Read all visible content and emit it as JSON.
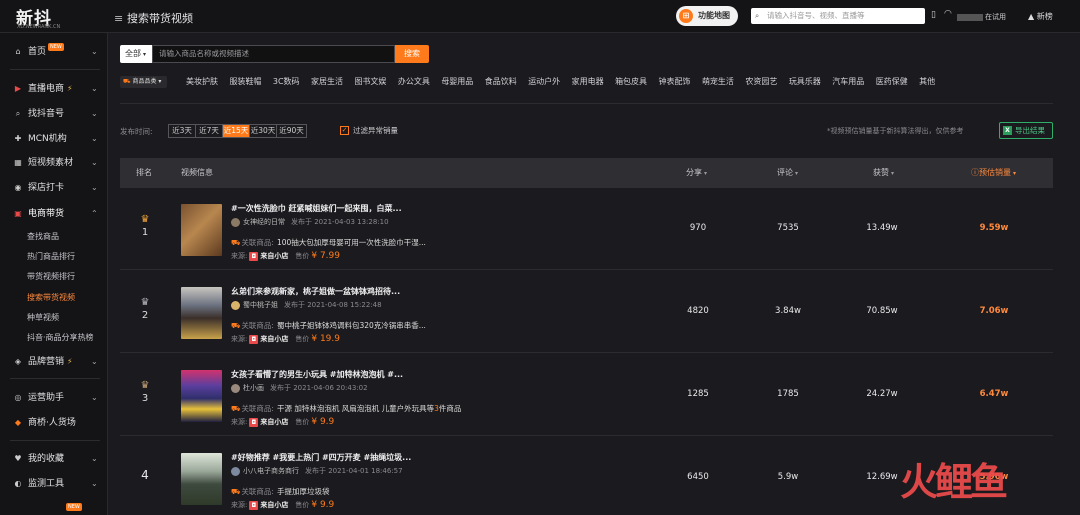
{
  "header": {
    "logo_text": "新抖",
    "logo_sub": "XD.NEWRANK.CN",
    "page_title": "搜索带货视频",
    "func_map": "功能地图",
    "search_placeholder": "请输入抖音号、视频、直播等",
    "trial": "在试用",
    "new_label": "新榜",
    "icons": [
      "menu-icon",
      "search-icon",
      "phone-icon",
      "headset-icon",
      "new-icon"
    ]
  },
  "sidebar": {
    "items": [
      {
        "label": "首页",
        "icon": "home-icon",
        "tag": "NEW"
      },
      {
        "label": "直播电商",
        "icon": "live-icon"
      },
      {
        "label": "找抖音号",
        "icon": "search-icon"
      },
      {
        "label": "MCN机构",
        "icon": "mcn-icon"
      },
      {
        "label": "短视频素材",
        "icon": "grid-icon"
      },
      {
        "label": "探店打卡",
        "icon": "location-icon"
      },
      {
        "label": "电商带货",
        "icon": "shop-icon"
      },
      {
        "label": "品牌营销",
        "icon": "brand-icon"
      },
      {
        "label": "运营助手",
        "icon": "assistant-icon"
      },
      {
        "label": "商桥·人货场",
        "icon": "bridge-icon"
      },
      {
        "label": "我的收藏",
        "icon": "heart-icon"
      },
      {
        "label": "监测工具",
        "icon": "monitor-icon"
      }
    ],
    "sub_items": [
      "查找商品",
      "热门商品排行",
      "带货视频排行",
      "搜索带货视频",
      "种草视频",
      "抖音·商品分享热榜"
    ],
    "bottom_tag": "NEW"
  },
  "search": {
    "scope": "全部",
    "placeholder": "请输入商品名称或视频描述",
    "button": "搜索"
  },
  "category": {
    "selector": "商品品类",
    "items": [
      "美妆护肤",
      "服装鞋帽",
      "3C数码",
      "家居生活",
      "图书文娱",
      "办公文具",
      "母婴用品",
      "食品饮料",
      "运动户外",
      "家用电器",
      "箱包皮具",
      "钟表配饰",
      "萌宠生活",
      "农资园艺",
      "玩具乐器",
      "汽车用品",
      "医药保健",
      "其他"
    ]
  },
  "filters": {
    "publish_label": "发布时间:",
    "periods": [
      "近3天",
      "近7天",
      "近15天",
      "近30天",
      "近90天"
    ],
    "active_period": "近15天",
    "exclude_label": "过滤异常销量",
    "exclude_checked": true,
    "note": "*视频预估销量基于新抖算法得出，仅供参考",
    "export": "导出结果"
  },
  "table": {
    "headers": {
      "rank": "排名",
      "video": "视频信息",
      "share": "分享",
      "comment": "评论",
      "like": "获赞",
      "sales": "预估销量"
    },
    "rows": [
      {
        "rank": "1",
        "title": "#一次性洗脸巾 赶紧喊姐妹们一起来囤，白菜...",
        "author": "女神经的日常",
        "publish": "发布于 2021-04-03 13:28:10",
        "product_label": "关联商品:",
        "product": "100抽大包加厚母婴可用一次性洗脸巾干湿...",
        "source_label": "来源:",
        "shop": "来自小店",
        "price_label": "售价",
        "price": "¥ 7.99",
        "share": "970",
        "comment": "7535",
        "like": "13.49w",
        "sales": "9.59w"
      },
      {
        "rank": "2",
        "title": "幺弟们来参观新家，桃子姐做一盆钵钵鸡招待...",
        "author": "蜀中桃子姐",
        "publish": "发布于 2021-04-08 15:22:48",
        "product_label": "关联商品:",
        "product": "蜀中桃子姐钵钵鸡调料包320克冷锅串串香...",
        "source_label": "来源:",
        "shop": "来自小店",
        "price_label": "售价",
        "price": "¥ 19.9",
        "share": "4820",
        "comment": "3.84w",
        "like": "70.85w",
        "sales": "7.06w"
      },
      {
        "rank": "3",
        "title": "女孩子看懵了的男生小玩具 #加特林泡泡机 #...",
        "author": "杜小画",
        "publish": "发布于 2021-04-06 20:43:02",
        "product_label": "关联商品:",
        "product": "干源 加特林泡泡机 风扇泡泡机 儿童户外玩具等",
        "product_count": "3",
        "product_suffix": "件商品",
        "source_label": "来源:",
        "shop": "来自小店",
        "price_label": "售价",
        "price": "¥ 9.9",
        "share": "1285",
        "comment": "1785",
        "like": "24.27w",
        "sales": "6.47w"
      },
      {
        "rank": "4",
        "title": "#好物推荐 #我要上热门 #四万开麦 #抽绳垃圾...",
        "author": "小八电子商务商行",
        "publish": "发布于 2021-04-01 18:46:57",
        "product_label": "关联商品:",
        "product": "手提加厚垃圾袋",
        "source_label": "来源:",
        "shop": "来自小店",
        "price_label": "售价",
        "price": "¥ 9.9",
        "share": "6450",
        "comment": "5.9w",
        "like": "12.69w",
        "sales": "5.96w"
      }
    ]
  },
  "colors": {
    "accent": "#ff7a1a",
    "background": "#1b1b1f",
    "sidebar": "#141417",
    "export_green": "#2fae6a"
  },
  "watermark": "火鲤鱼"
}
